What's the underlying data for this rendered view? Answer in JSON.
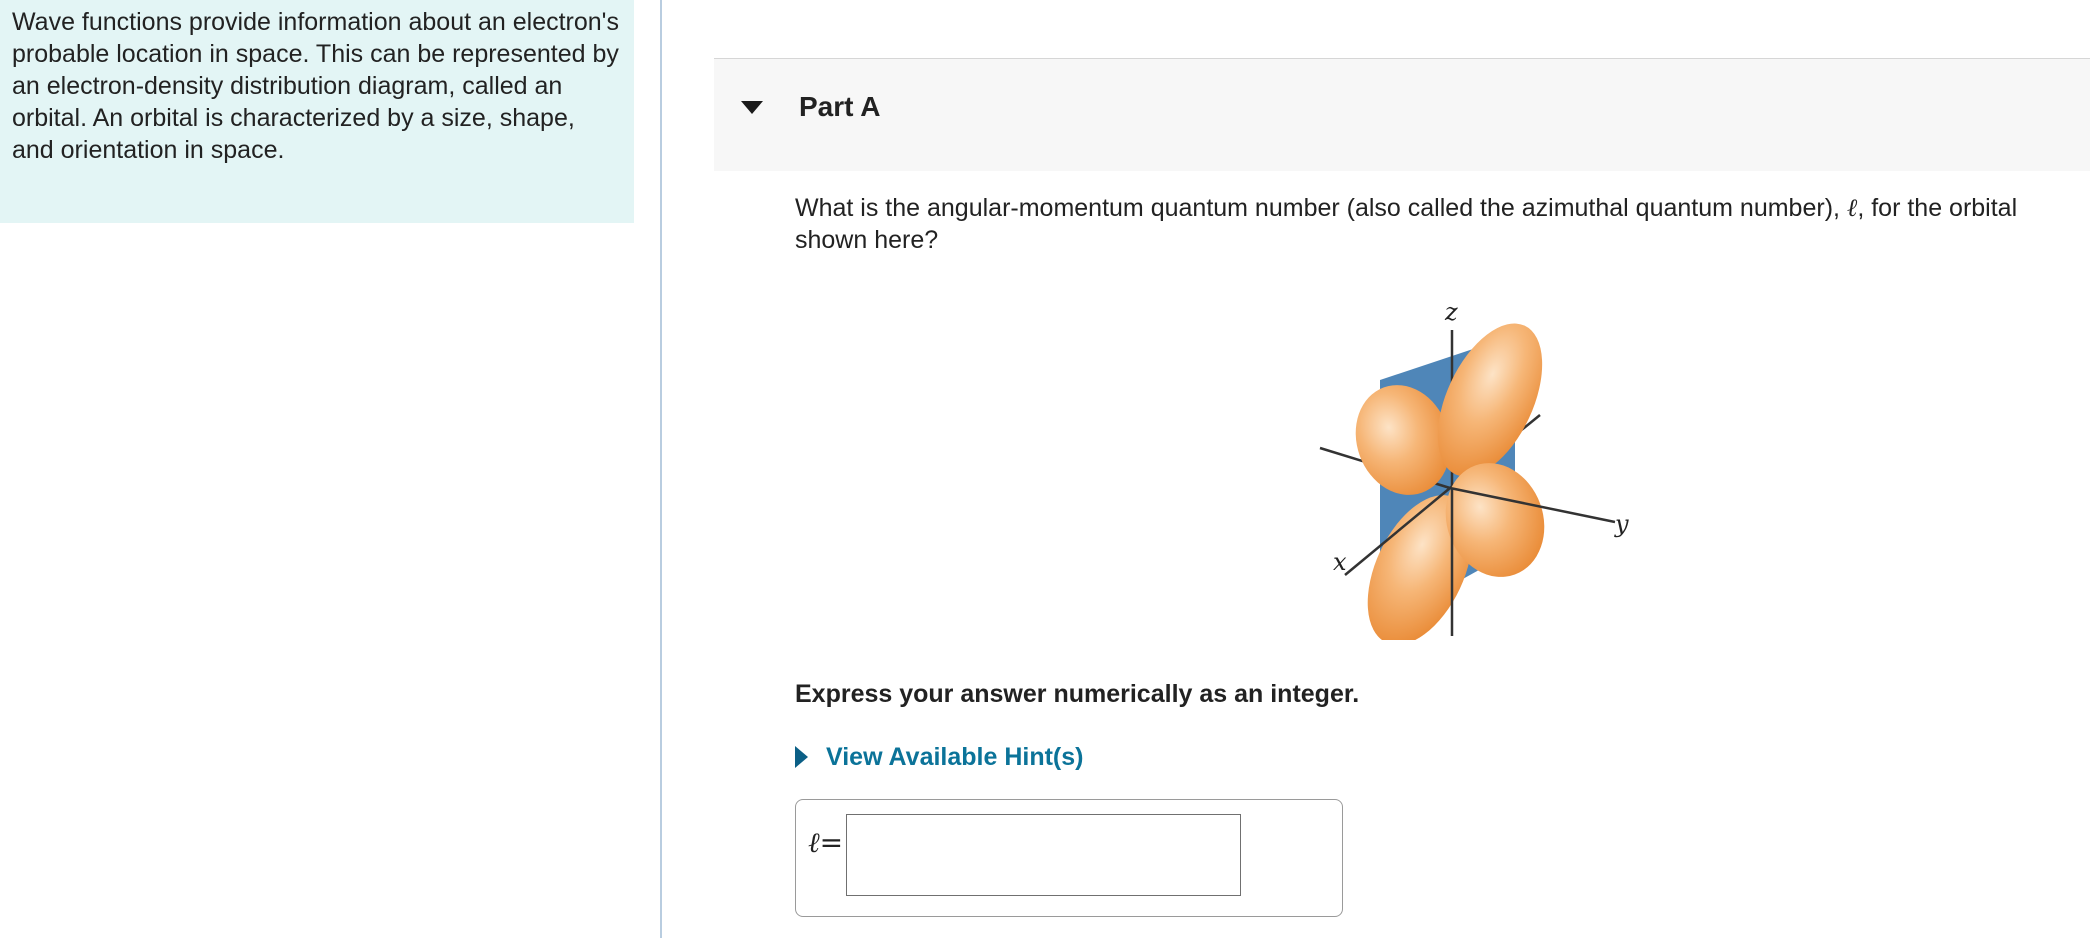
{
  "intro": {
    "text": "Wave functions provide information about an electron's probable location in space. This can be represented by an electron-density distribution diagram, called an orbital.  An orbital is characterized by a size, shape, and orientation in space."
  },
  "part": {
    "title": "Part A"
  },
  "question": {
    "text_before": "What is the angular-momentum quantum number (also called the azimuthal quantum number), ",
    "symbol": "ℓ",
    "text_after": ", for the orbital shown here?"
  },
  "figure": {
    "axis_labels": {
      "x": "x",
      "y": "y",
      "z": "z"
    },
    "colors": {
      "lobe": "#f2a35a",
      "lobe_light": "#f8c99a",
      "plane": "#4f86b8",
      "axis": "#333333"
    }
  },
  "instruction": "Express your answer numerically as an integer.",
  "hint": {
    "label": "View Available Hint(s)"
  },
  "answer": {
    "label": "ℓ=",
    "value": ""
  }
}
